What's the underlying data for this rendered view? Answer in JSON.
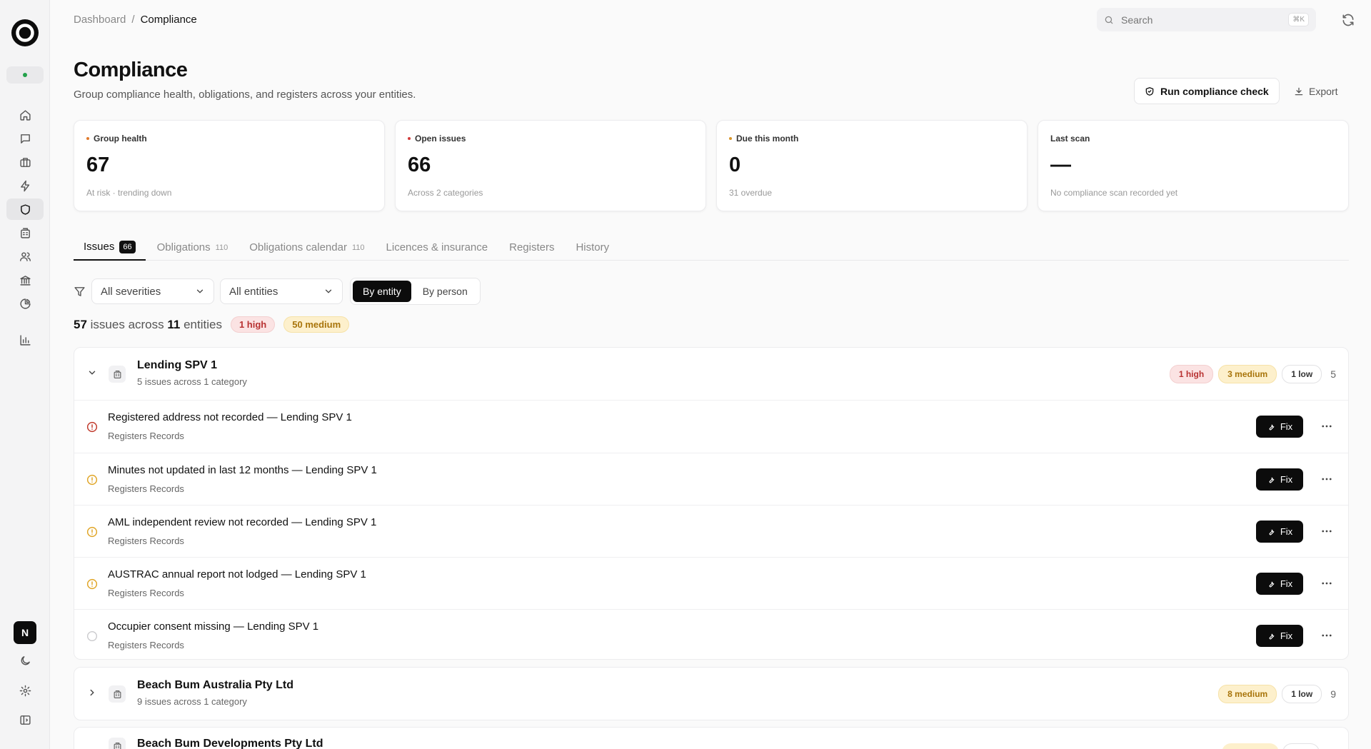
{
  "breadcrumb": {
    "parent": "Dashboard",
    "sep": "/",
    "current": "Compliance"
  },
  "search": {
    "placeholder": "Search",
    "shortcut": "⌘K"
  },
  "page": {
    "title": "Compliance",
    "subtitle": "Group compliance health, obligations, and registers across your entities."
  },
  "actions": {
    "run": "Run compliance check",
    "export": "Export"
  },
  "cards": [
    {
      "label": "Group health",
      "value": "67",
      "note": "At risk · trending down",
      "dot": "#e07a2c"
    },
    {
      "label": "Open issues",
      "value": "66",
      "note": "Across 2 categories",
      "dot": "#d23c3c"
    },
    {
      "label": "Due this month",
      "value": "0",
      "note": "31 overdue",
      "dot": "#d8952a"
    },
    {
      "label": "Last scan",
      "value": "—",
      "note": "No compliance scan recorded yet"
    }
  ],
  "tabs": [
    {
      "label": "Issues",
      "count": "66"
    },
    {
      "label": "Obligations",
      "count": "110"
    },
    {
      "label": "Obligations calendar",
      "count": "110"
    },
    {
      "label": "Licences & insurance"
    },
    {
      "label": "Registers"
    },
    {
      "label": "History"
    }
  ],
  "filters": {
    "severity": "All severities",
    "entity": "All entities",
    "mode_entity": "By entity",
    "mode_person": "By person"
  },
  "summary": {
    "issues": "57",
    "t1": "issues across",
    "entities": "11",
    "t2": "entities",
    "high": "1 high",
    "medium": "50 medium"
  },
  "groups": [
    {
      "name": "Lending SPV 1",
      "sub": "5 issues across 1 category",
      "high": "1 high",
      "medium": "3 medium",
      "low": "1 low",
      "count": "5",
      "issues": [
        {
          "title": "Registered address not recorded — Lending SPV 1",
          "sub": "Registers Records",
          "severity": "high"
        },
        {
          "title": "Minutes not updated in last 12 months — Lending SPV 1",
          "sub": "Registers Records",
          "severity": "medium"
        },
        {
          "title": "AML independent review not recorded — Lending SPV 1",
          "sub": "Registers Records",
          "severity": "medium"
        },
        {
          "title": "AUSTRAC annual report not lodged — Lending SPV 1",
          "sub": "Registers Records",
          "severity": "medium"
        },
        {
          "title": "Occupier consent missing — Lending SPV 1",
          "sub": "Registers Records",
          "severity": "low"
        }
      ]
    },
    {
      "name": "Beach Bum Australia Pty Ltd",
      "sub": "9 issues across 1 category",
      "medium": "8 medium",
      "low": "1 low",
      "count": "9"
    },
    {
      "name": "Beach Bum Developments Pty Ltd"
    }
  ],
  "fix_label": "Fix",
  "user_initial": "N",
  "colors": {
    "high": "#c0392b",
    "medium": "#e0a526",
    "low": "#c9c9cc",
    "accent": "#0c0c0c"
  }
}
